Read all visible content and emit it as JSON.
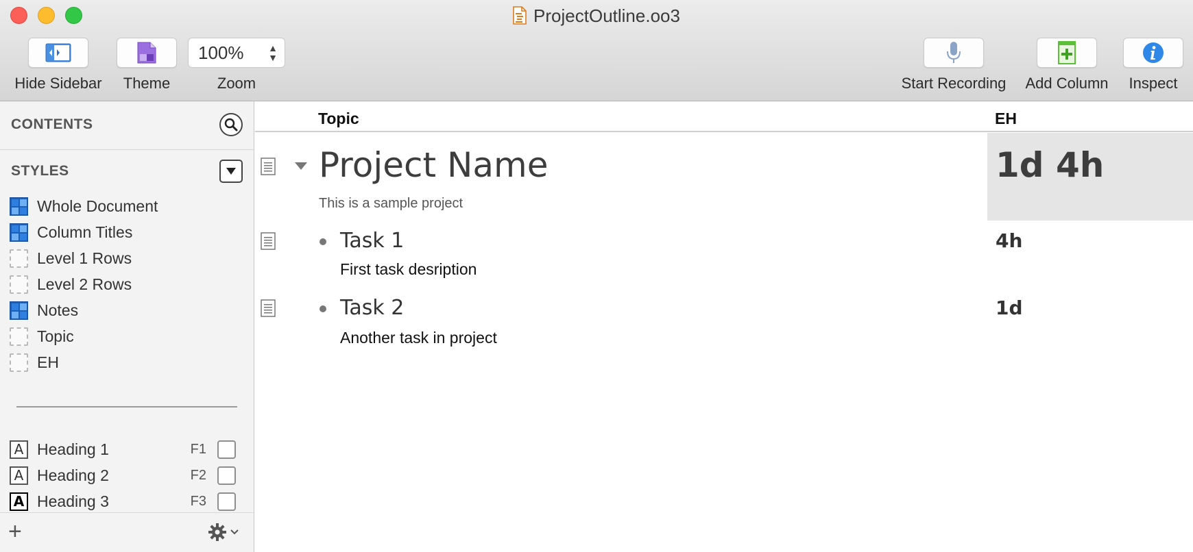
{
  "window": {
    "title": "ProjectOutline.oo3"
  },
  "toolbar": {
    "hide_sidebar": "Hide Sidebar",
    "theme": "Theme",
    "zoom_label": "Zoom",
    "zoom_value": "100%",
    "start_recording": "Start Recording",
    "add_column": "Add Column",
    "inspect": "Inspect"
  },
  "sidebar": {
    "contents_header": "CONTENTS",
    "styles_header": "STYLES",
    "styles": [
      {
        "label": "Whole Document",
        "swatch": "blue"
      },
      {
        "label": "Column Titles",
        "swatch": "blue"
      },
      {
        "label": "Level 1 Rows",
        "swatch": "dashed"
      },
      {
        "label": "Level 2 Rows",
        "swatch": "dashed"
      },
      {
        "label": "Notes",
        "swatch": "blue"
      },
      {
        "label": "Topic",
        "swatch": "dashed"
      },
      {
        "label": "EH",
        "swatch": "dashed"
      }
    ],
    "named_styles": [
      {
        "icon_letter": "A",
        "label": "Heading 1",
        "key": "F1"
      },
      {
        "icon_letter": "A",
        "label": "Heading 2",
        "key": "F2"
      },
      {
        "icon_letter": "A",
        "label": "Heading 3",
        "key": "F3"
      }
    ]
  },
  "outline": {
    "columns": {
      "topic": "Topic",
      "eh": "EH"
    },
    "rows": [
      {
        "level": 0,
        "title": "Project Name",
        "note": "This is a sample project",
        "eh": "1d 4h"
      },
      {
        "level": 1,
        "title": "Task 1",
        "note": "First task desription",
        "eh": "4h"
      },
      {
        "level": 1,
        "title": "Task 2",
        "note": "Another task in project",
        "eh": "1d"
      }
    ]
  },
  "colors": {
    "close": "#fc5f57",
    "minimize": "#fdbc2e",
    "zoom": "#33c748",
    "accent_blue": "#2f7fe0",
    "add_column_green": "#5bbf3a",
    "theme_purple": "#8a5bd0"
  }
}
